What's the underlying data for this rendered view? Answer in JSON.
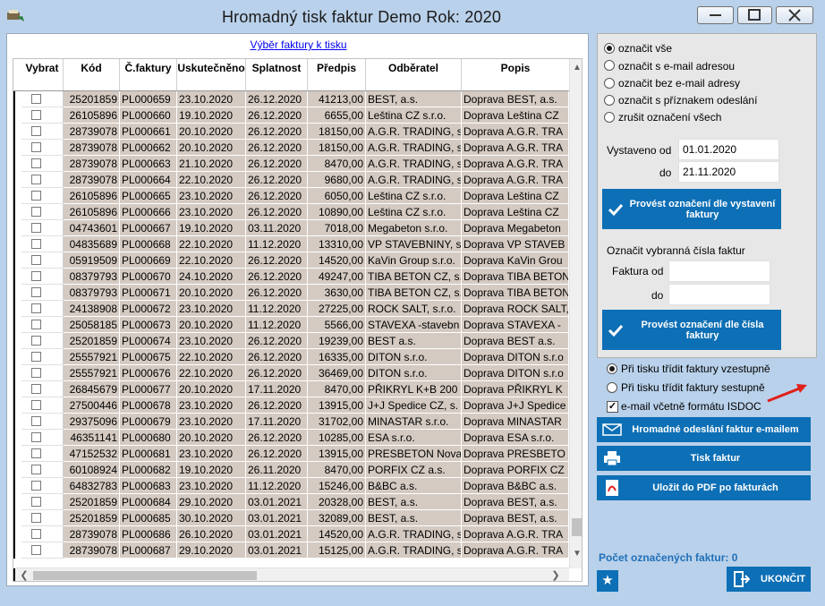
{
  "window": {
    "title": "Hromadný tisk faktur  Demo  Rok: 2020"
  },
  "left_panel": {
    "link": "Výběr faktury k tisku"
  },
  "table": {
    "columns": [
      "Vybrat",
      "Kód",
      "Č.faktury",
      "Uskutečněno",
      "Splatnost",
      "Předpis",
      "Odběratel",
      "Popis"
    ],
    "rows": [
      {
        "kod": "25201859",
        "cislo": "PL000659",
        "usk": "23.10.2020",
        "spl": "26.12.2020",
        "predpis": "41213,00",
        "odb": "BEST, a.s.",
        "popis": "Doprava BEST, a.s."
      },
      {
        "kod": "26105896",
        "cislo": "PL000660",
        "usk": "19.10.2020",
        "spl": "26.12.2020",
        "predpis": "6655,00",
        "odb": "Leština  CZ s.r.o.",
        "popis": "Doprava Leština  CZ"
      },
      {
        "kod": "28739078",
        "cislo": "PL000661",
        "usk": "20.10.2020",
        "spl": "26.12.2020",
        "predpis": "18150,00",
        "odb": "A.G.R.  TRADING, s",
        "popis": "Doprava A.G.R.  TRA"
      },
      {
        "kod": "28739078",
        "cislo": "PL000662",
        "usk": "20.10.2020",
        "spl": "26.12.2020",
        "predpis": "18150,00",
        "odb": "A.G.R.  TRADING, s",
        "popis": "Doprava A.G.R.  TRA"
      },
      {
        "kod": "28739078",
        "cislo": "PL000663",
        "usk": "21.10.2020",
        "spl": "26.12.2020",
        "predpis": "8470,00",
        "odb": "A.G.R.  TRADING, s",
        "popis": "Doprava A.G.R.  TRA"
      },
      {
        "kod": "28739078",
        "cislo": "PL000664",
        "usk": "22.10.2020",
        "spl": "26.12.2020",
        "predpis": "9680,00",
        "odb": "A.G.R.  TRADING, s",
        "popis": "Doprava A.G.R.  TRA"
      },
      {
        "kod": "26105896",
        "cislo": "PL000665",
        "usk": "23.10.2020",
        "spl": "26.12.2020",
        "predpis": "6050,00",
        "odb": "Leština  CZ s.r.o.",
        "popis": "Doprava Leština  CZ"
      },
      {
        "kod": "26105896",
        "cislo": "PL000666",
        "usk": "23.10.2020",
        "spl": "26.12.2020",
        "predpis": "10890,00",
        "odb": "Leština  CZ s.r.o.",
        "popis": "Doprava Leština  CZ"
      },
      {
        "kod": "04743601",
        "cislo": "PL000667",
        "usk": "19.10.2020",
        "spl": "03.11.2020",
        "predpis": "7018,00",
        "odb": "Megabeton s.r.o.",
        "popis": "Doprava Megabeton"
      },
      {
        "kod": "04835689",
        "cislo": "PL000668",
        "usk": "22.10.2020",
        "spl": "11.12.2020",
        "predpis": "13310,00",
        "odb": "VP STAVEBNINY, s",
        "popis": "Doprava VP STAVEB"
      },
      {
        "kod": "05919509",
        "cislo": "PL000669",
        "usk": "22.10.2020",
        "spl": "26.12.2020",
        "predpis": "14520,00",
        "odb": "KaVin Group s.r.o.",
        "popis": "Doprava KaVin Grou"
      },
      {
        "kod": "08379793",
        "cislo": "PL000670",
        "usk": "24.10.2020",
        "spl": "26.12.2020",
        "predpis": "49247,00",
        "odb": "TIBA BETON CZ, s.",
        "popis": "Doprava TIBA BETON"
      },
      {
        "kod": "08379793",
        "cislo": "PL000671",
        "usk": "20.10.2020",
        "spl": "26.12.2020",
        "predpis": "3630,00",
        "odb": "TIBA BETON CZ, s.",
        "popis": "Doprava TIBA BETON"
      },
      {
        "kod": "24138908",
        "cislo": "PL000672",
        "usk": "23.10.2020",
        "spl": "11.12.2020",
        "predpis": "27225,00",
        "odb": "ROCK SALT, s.r.o.",
        "popis": "Doprava ROCK SALT,"
      },
      {
        "kod": "25058185",
        "cislo": "PL000673",
        "usk": "20.10.2020",
        "spl": "11.12.2020",
        "predpis": "5566,00",
        "odb": "STAVEXA  -stavebn",
        "popis": "Doprava STAVEXA  -"
      },
      {
        "kod": "25201859",
        "cislo": "PL000674",
        "usk": "23.10.2020",
        "spl": "26.12.2020",
        "predpis": "19239,00",
        "odb": "BEST a.s.",
        "popis": "Doprava BEST a.s."
      },
      {
        "kod": "25557921",
        "cislo": "PL000675",
        "usk": "22.10.2020",
        "spl": "26.12.2020",
        "predpis": "16335,00",
        "odb": "DITON s.r.o.",
        "popis": "Doprava DITON s.r.o"
      },
      {
        "kod": "25557921",
        "cislo": "PL000676",
        "usk": "22.10.2020",
        "spl": "26.12.2020",
        "predpis": "36469,00",
        "odb": "DITON s.r.o.",
        "popis": "Doprava DITON s.r.o"
      },
      {
        "kod": "26845679",
        "cislo": "PL000677",
        "usk": "20.10.2020",
        "spl": "17.11.2020",
        "predpis": "8470,00",
        "odb": "PŘIKRYL K+B 200",
        "popis": "Doprava PŘIKRYL K"
      },
      {
        "kod": "27500446",
        "cislo": "PL000678",
        "usk": "23.10.2020",
        "spl": "26.12.2020",
        "predpis": "13915,00",
        "odb": "J+J Spedice CZ, s.",
        "popis": "Doprava J+J Spedice"
      },
      {
        "kod": "29375096",
        "cislo": "PL000679",
        "usk": "23.10.2020",
        "spl": "17.11.2020",
        "predpis": "31702,00",
        "odb": "MINASTAR s.r.o.",
        "popis": "Doprava MINASTAR"
      },
      {
        "kod": "46351141",
        "cislo": "PL000680",
        "usk": "20.10.2020",
        "spl": "26.12.2020",
        "predpis": "10285,00",
        "odb": "ESA s.r.o.",
        "popis": "Doprava ESA s.r.o."
      },
      {
        "kod": "47152532",
        "cislo": "PL000681",
        "usk": "23.10.2020",
        "spl": "26.12.2020",
        "predpis": "13915,00",
        "odb": "PRESBETON Nova",
        "popis": "Doprava PRESBETO"
      },
      {
        "kod": "60108924",
        "cislo": "PL000682",
        "usk": "19.10.2020",
        "spl": "26.11.2020",
        "predpis": "8470,00",
        "odb": "PORFIX CZ a.s.",
        "popis": "Doprava PORFIX CZ"
      },
      {
        "kod": "64832783",
        "cislo": "PL000683",
        "usk": "23.10.2020",
        "spl": "11.12.2020",
        "predpis": "15246,00",
        "odb": "B&BC a.s.",
        "popis": "Doprava B&BC a.s."
      },
      {
        "kod": "25201859",
        "cislo": "PL000684",
        "usk": "29.10.2020",
        "spl": "03.01.2021",
        "predpis": "20328,00",
        "odb": "BEST, a.s.",
        "popis": "Doprava BEST, a.s."
      },
      {
        "kod": "25201859",
        "cislo": "PL000685",
        "usk": "30.10.2020",
        "spl": "03.01.2021",
        "predpis": "32089,00",
        "odb": "BEST, a.s.",
        "popis": "Doprava BEST, a.s."
      },
      {
        "kod": "28739078",
        "cislo": "PL000686",
        "usk": "26.10.2020",
        "spl": "03.01.2021",
        "predpis": "14520,00",
        "odb": "A.G.R.  TRADING, s",
        "popis": "Doprava A.G.R.  TRA"
      },
      {
        "kod": "28739078",
        "cislo": "PL000687",
        "usk": "29.10.2020",
        "spl": "03.01.2021",
        "predpis": "15125,00",
        "odb": "A.G.R.  TRADING, s",
        "popis": "Doprava A.G.R.  TRA"
      }
    ]
  },
  "right_panel": {
    "radios": [
      {
        "label": "označit vše",
        "selected": true
      },
      {
        "label": "označit s e-mail adresou",
        "selected": false
      },
      {
        "label": "označit bez e-mail adresy",
        "selected": false
      },
      {
        "label": "označit s příznakem odeslání",
        "selected": false
      },
      {
        "label": "zrušit označení všech",
        "selected": false
      }
    ],
    "vystaveno_od_label": "Vystaveno od",
    "vystaveno_od_value": "01.01.2020",
    "do_label": "do",
    "do_value": "21.11.2020",
    "btn_date_label": "Provést označení dle vystavení faktury",
    "oznacit_cisla_label": "Označit vybranná čísla faktur",
    "faktura_od_label": "Faktura od",
    "faktura_od_value": "",
    "faktura_do_label": "do",
    "faktura_do_value": "",
    "btn_number_label": "Provést označení dle čísla faktury"
  },
  "options": {
    "sort_asc": "Při tisku třídit faktury vzestupně",
    "sort_desc": "Při tisku třídit faktury sestupně",
    "isdoc": "e-mail včetně formátu ISDOC",
    "isdoc_checked": "✓"
  },
  "actions": {
    "email_btn": "Hromadné odeslání faktur e-mailem",
    "print_btn": "Tisk faktur",
    "pdf_btn": "Uložit do PDF po fakturách"
  },
  "footer": {
    "count_label": "Počet označených faktur:  0",
    "star": "★",
    "end_btn": "UKONČIT"
  },
  "colors": {
    "accent": "#0d6fb5",
    "row_bg": "#d4cac2",
    "window_bg": "#b9d1ea"
  }
}
